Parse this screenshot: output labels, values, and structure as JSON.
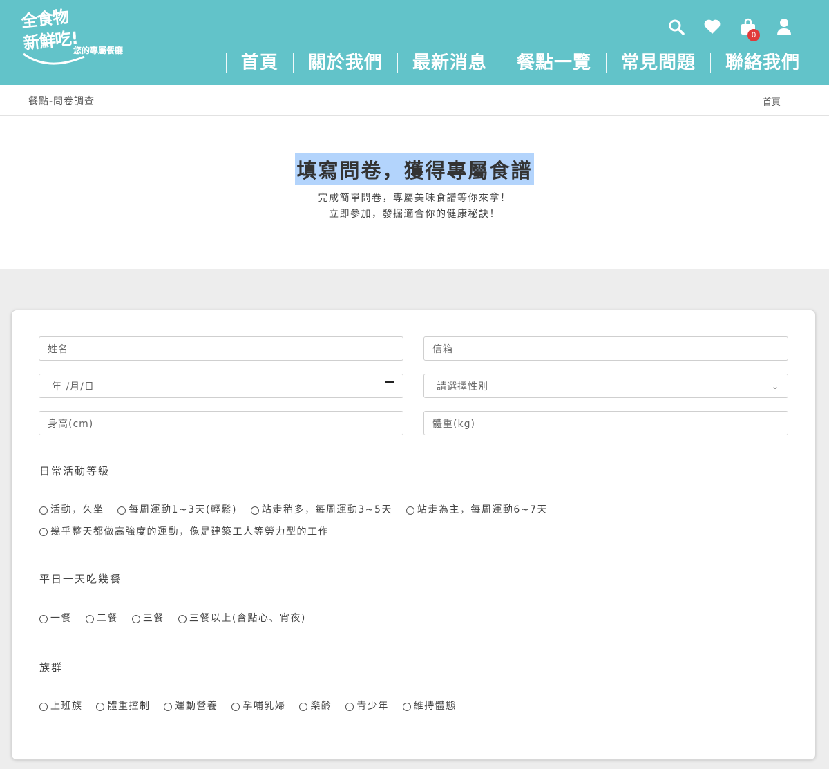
{
  "header": {
    "logo": {
      "line1": "全食物",
      "line2": "新鮮吃!",
      "tagline": "您的專屬餐廳"
    },
    "cart_count": "0",
    "nav": [
      "首頁",
      "關於我們",
      "最新消息",
      "餐點一覽",
      "常見問題",
      "聯絡我們"
    ]
  },
  "breadcrumb": {
    "current": "餐點-問卷調查",
    "home": "首頁"
  },
  "hero": {
    "title": "填寫問卷，獲得專屬食譜",
    "line1": "完成簡單問卷，專屬美味食譜等你來拿！",
    "line2": "立即參加，發掘適合你的健康秘訣！"
  },
  "form": {
    "name_placeholder": "姓名",
    "email_placeholder": "信箱",
    "date_placeholder": "年 /月/日",
    "gender_placeholder": "請選擇性別",
    "height_placeholder": "身高(cm)",
    "weight_placeholder": "體重(kg)",
    "activity": {
      "label": "日常活動等級",
      "options": [
        "活動，久坐",
        "每周運動1~3天(輕鬆)",
        "站走稍多，每周運動3~5天",
        "站走為主，每周運動6~7天",
        "幾乎整天都做高強度的運動，像是建築工人等勞力型的工作"
      ]
    },
    "meals": {
      "label": "平日一天吃幾餐",
      "options": [
        "一餐",
        "二餐",
        "三餐",
        "三餐以上(含點心、宵夜)"
      ]
    },
    "group": {
      "label": "族群",
      "options": [
        "上班族",
        "體重控制",
        "運動營養",
        "孕哺乳婦",
        "樂齡",
        "青少年",
        "維持體態"
      ]
    }
  }
}
